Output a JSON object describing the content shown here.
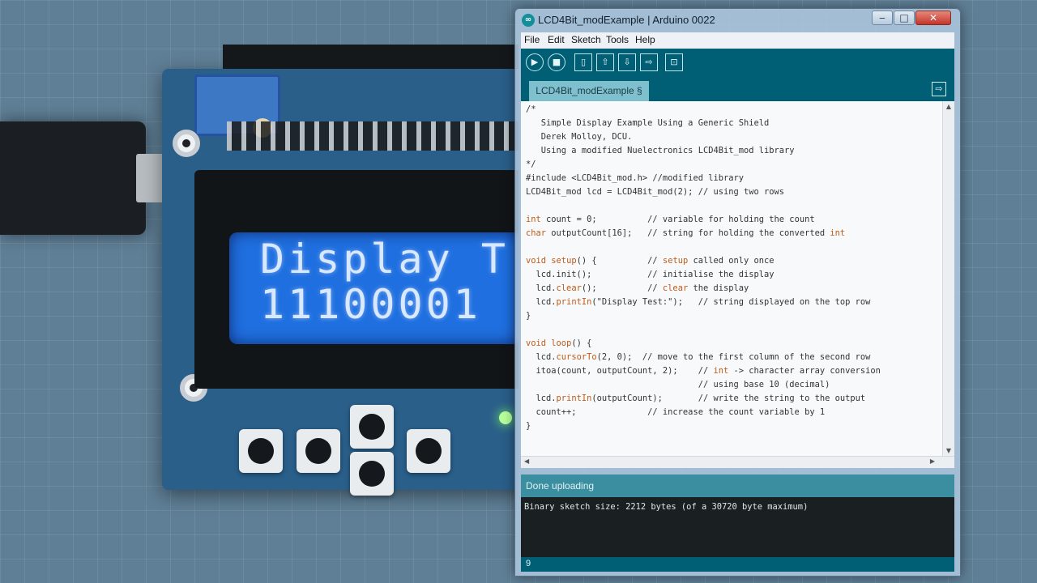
{
  "lcd": {
    "line1": "Display T",
    "line2": "11100001"
  },
  "window": {
    "title": "LCD4Bit_modExample | Arduino 0022",
    "controls": {
      "minimize": "‒",
      "maximize": "□",
      "close": "✕"
    }
  },
  "menu": [
    "File",
    "Edit",
    "Sketch",
    "Tools",
    "Help"
  ],
  "toolbar": {
    "buttons": [
      {
        "name": "verify",
        "glyph": "▶"
      },
      {
        "name": "stop",
        "glyph": "■"
      },
      {
        "name": "new",
        "glyph": "▯"
      },
      {
        "name": "open",
        "glyph": "⇧"
      },
      {
        "name": "save",
        "glyph": "⇩"
      },
      {
        "name": "upload",
        "glyph": "⇨"
      },
      {
        "name": "serial-monitor",
        "glyph": "⊡"
      }
    ]
  },
  "tab": {
    "label": "LCD4Bit_modExample §",
    "menu_glyph": "⇨"
  },
  "code": [
    "/*",
    "   Simple Display Example Using a Generic Shield",
    "   Derek Molloy, DCU.",
    "   Using a modified Nuelectronics LCD4Bit_mod library",
    "*/",
    "#include <LCD4Bit_mod.h> //modified library",
    "LCD4Bit_mod lcd = LCD4Bit_mod(2); // using two rows",
    "",
    "int count = 0;          // variable for holding the count",
    "char outputCount[16];   // string for holding the converted int",
    "",
    "void setup() {          // setup called only once",
    "  lcd.init();           // initialise the display",
    "  lcd.clear();          // clear the display",
    "  lcd.printIn(\"Display Test:\");   // string displayed on the top row",
    "}",
    "",
    "void loop() {",
    "  lcd.cursorTo(2, 0);  // move to the first column of the second row",
    "  itoa(count, outputCount, 2);    // int -> character array conversion",
    "                                  // using base 10 (decimal)",
    "  lcd.printIn(outputCount);       // write the string to the output",
    "  count++;              // increase the count variable by 1",
    "}"
  ],
  "status": "Done uploading",
  "console": "Binary sketch size: 2212 bytes (of a 30720 byte maximum)",
  "line_number": "9",
  "colors": {
    "toolbar": "#005f75",
    "lcd_backlight": "#1f6fe0",
    "keyword": "#c05a16"
  }
}
